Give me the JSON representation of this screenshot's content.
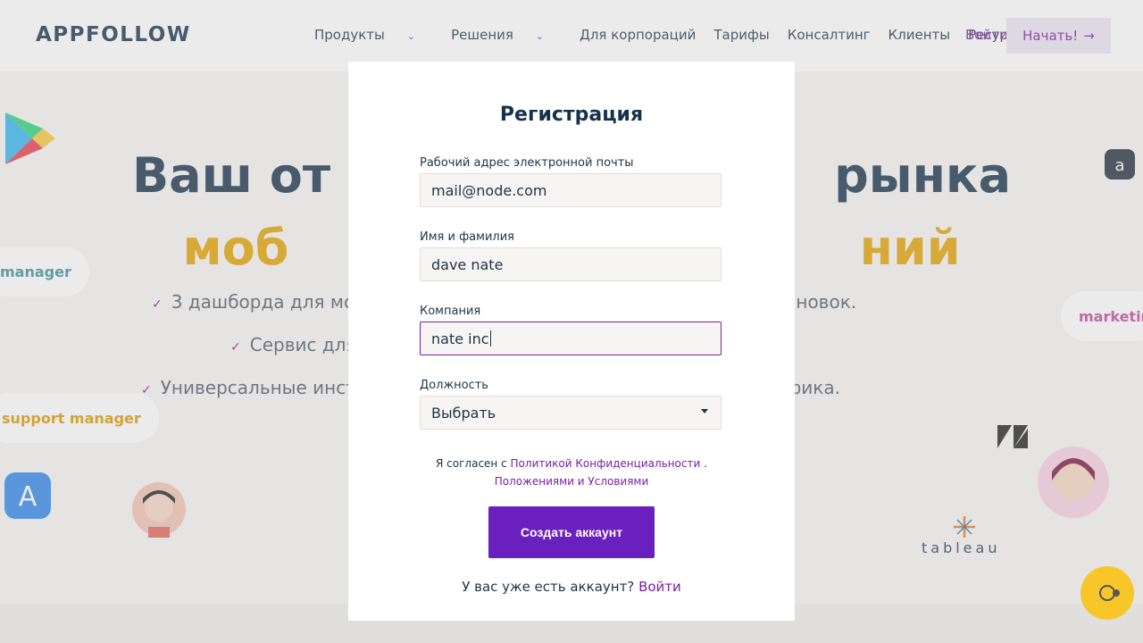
{
  "header": {
    "logo": "APPFOLLOW",
    "nav": [
      "Продукты",
      "Решения",
      "Для корпораций",
      "Тарифы",
      "Консалтинг",
      "Клиенты",
      "Ресурсы"
    ],
    "login": "Войти",
    "start": "Начать!"
  },
  "hero": {
    "title_line1": "Ваш от                              рынка",
    "title_line2": "моб                                  ний",
    "features": [
      "3 дашборда для мо                                                        ических установок.",
      "Сервис для                                                  за отзывов.",
      "Универсальные инст                                                  анического трафика."
    ],
    "pills": [
      "manager",
      "support manager",
      "marketing"
    ],
    "brand_logo": "tableau"
  },
  "modal": {
    "title": "Регистрация",
    "email_label": "Рабочий адрес электронной почты",
    "email_value": "mail@node.com",
    "name_label": "Имя и фамилия",
    "name_value": "dave nate",
    "company_label": "Компания",
    "company_value": "nate inc",
    "position_label": "Должность",
    "position_value": "Выбрать",
    "terms_prefix": "Я согласен с",
    "terms_privacy": "Политикой Конфиденциальности",
    "terms_sep": ".",
    "terms_conditions": "Положениями и Условиями",
    "create_button": "Создать аккаунт",
    "have_account": "У вас уже есть аккаунт?",
    "login_link": "Войти"
  },
  "colors": {
    "accent": "#7b1fa2",
    "primary_button": "#6a1fbf",
    "title_dark": "#16324a",
    "title_gold": "#e3a200"
  }
}
